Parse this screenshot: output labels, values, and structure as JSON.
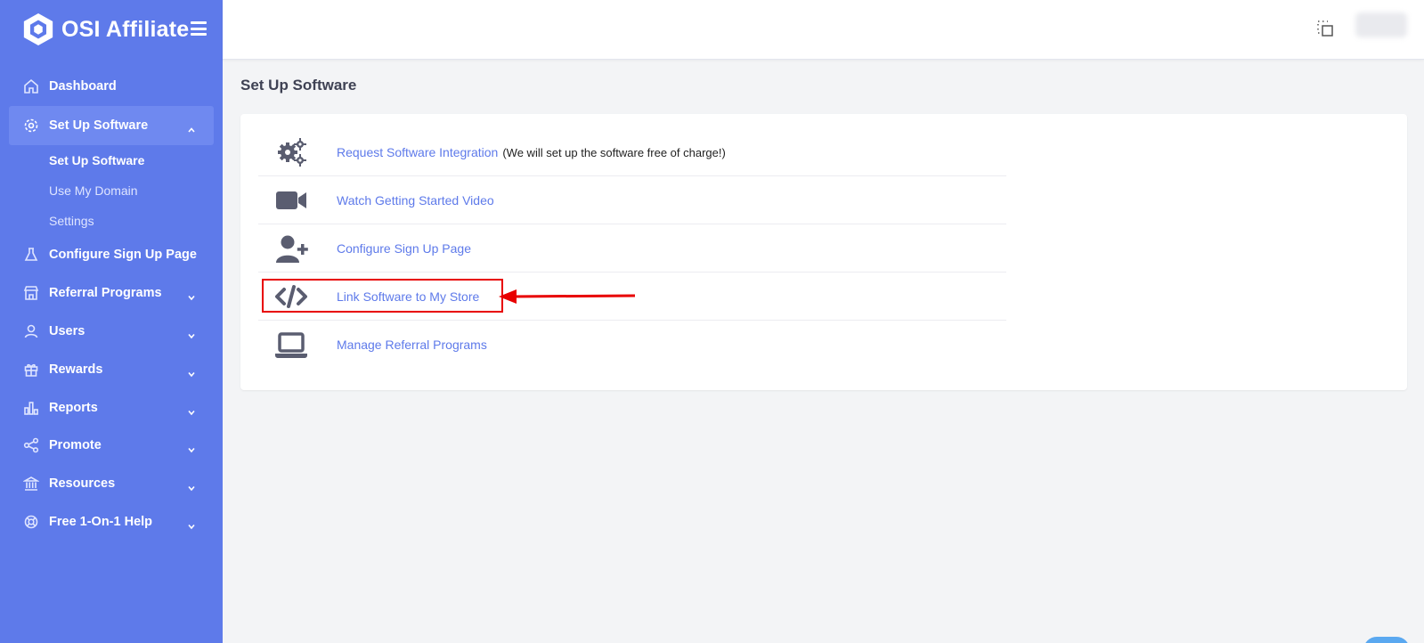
{
  "brand": {
    "name": "OSI Affiliate"
  },
  "sidebar": {
    "items": [
      {
        "label": "Dashboard",
        "icon": "home-icon"
      },
      {
        "label": "Set Up Software",
        "icon": "gear-icon"
      },
      {
        "label": "Configure Sign Up Page",
        "icon": "flask-icon"
      },
      {
        "label": "Referral Programs",
        "icon": "store-icon"
      },
      {
        "label": "Users",
        "icon": "user-icon"
      },
      {
        "label": "Rewards",
        "icon": "gift-icon"
      },
      {
        "label": "Reports",
        "icon": "bar-chart-icon"
      },
      {
        "label": "Promote",
        "icon": "share-icon"
      },
      {
        "label": "Resources",
        "icon": "bank-icon"
      },
      {
        "label": "Free 1-On-1 Help",
        "icon": "lifebuoy-icon"
      }
    ],
    "subitems": [
      {
        "label": "Set Up Software"
      },
      {
        "label": "Use My Domain"
      },
      {
        "label": "Settings"
      }
    ]
  },
  "main": {
    "title": "Set Up Software",
    "rows": [
      {
        "label": "Request Software Integration",
        "note": "(We will set up the software free of charge!)",
        "icon": "gears-icon"
      },
      {
        "label": "Watch Getting Started Video",
        "icon": "video-camera-icon"
      },
      {
        "label": "Configure Sign Up Page",
        "icon": "user-plus-icon"
      },
      {
        "label": "Link Software to My Store",
        "icon": "code-icon"
      },
      {
        "label": "Manage Referral Programs",
        "icon": "laptop-icon"
      }
    ]
  },
  "colors": {
    "sidebar": "#5e7aea",
    "link": "#5e7aea",
    "highlight": "#e80000"
  }
}
